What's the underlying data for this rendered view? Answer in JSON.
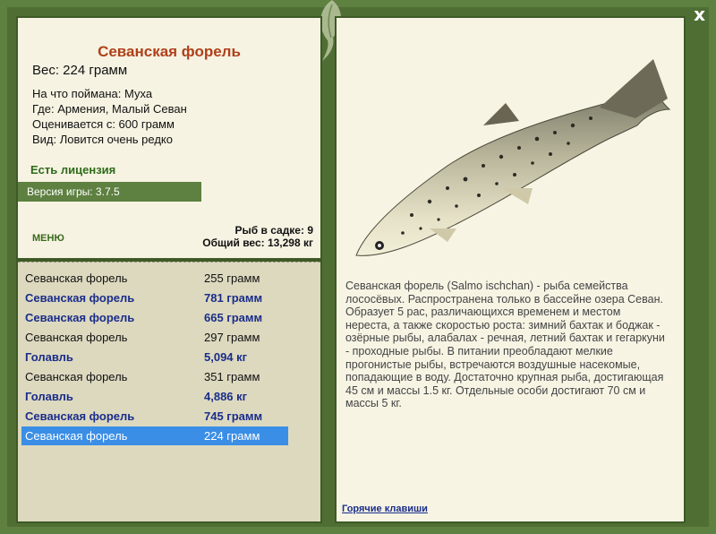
{
  "window": {
    "close_label": "x"
  },
  "fish": {
    "name": "Севанская форель",
    "weight": "Вес: 224 грамм",
    "bait": "На что поймана: Муха",
    "where": "Где: Армения, Малый Севан",
    "value": "Оценивается с: 600 грамм",
    "kind": "Вид: Ловится очень редко"
  },
  "license": "Есть лицензия",
  "version": "Версия игры: 3.7.5",
  "menu_label": "МЕНЮ",
  "stats": {
    "count": "Рыб в садке: 9",
    "total": "Общий вес: 13,298 кг"
  },
  "catch_list": [
    {
      "name": "Севанская форель",
      "weight": "255 грамм",
      "style": "norm"
    },
    {
      "name": "Севанская форель",
      "weight": "781 грамм",
      "style": "bold"
    },
    {
      "name": "Севанская форель",
      "weight": "665 грамм",
      "style": "bold"
    },
    {
      "name": "Севанская форель",
      "weight": "297 грамм",
      "style": "norm"
    },
    {
      "name": "Голавль",
      "weight": "5,094 кг",
      "style": "bold"
    },
    {
      "name": "Севанская форель",
      "weight": "351 грамм",
      "style": "norm"
    },
    {
      "name": "Голавль",
      "weight": "4,886 кг",
      "style": "bold"
    },
    {
      "name": "Севанская форель",
      "weight": "745 грамм",
      "style": "bold"
    },
    {
      "name": "Севанская форель",
      "weight": "224 грамм",
      "style": "sel"
    }
  ],
  "description": "Севанская форель (Salmo ischchan) - рыба семейства лососёвых. Распространена только в бассейне озера Севан. Образует 5 рас, различающихся временем и местом нереста, а также скоростью роста: зимний бахтак и боджак - озёрные рыбы, алабалах - речная, летний бахтак и гегаркуни - проходные рыбы. В питании преобладают мелкие прогонистые рыбы, встречаются воздушные насекомые, попадающие в воду. Достаточно крупная рыба, достигающая 45 см и массы 1.5 кг. Отдельные особи достигают 70 см и массы 5 кг.",
  "hotkeys": "Горячие клавиши"
}
